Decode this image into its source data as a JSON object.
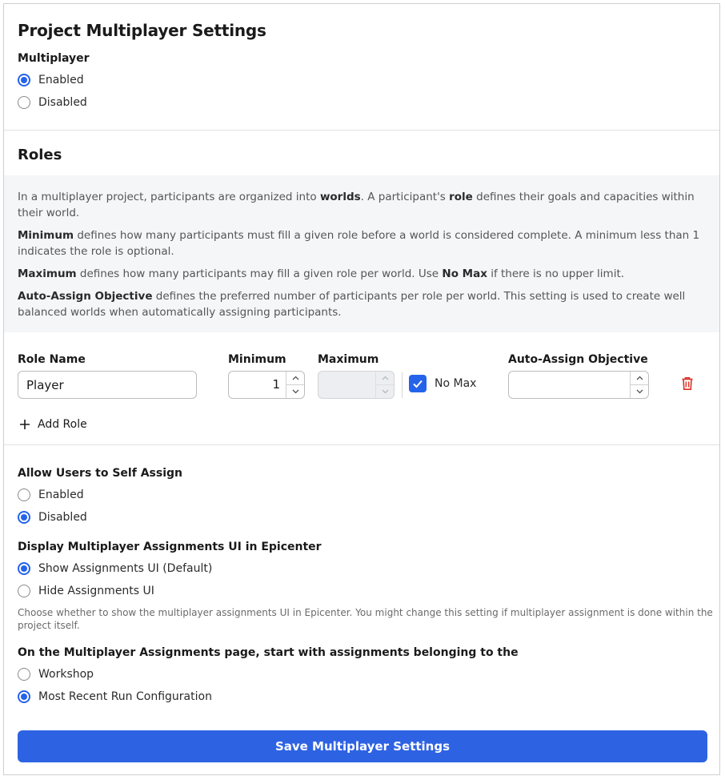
{
  "header": {
    "title": "Project Multiplayer Settings"
  },
  "multiplayer": {
    "label": "Multiplayer",
    "options": [
      "Enabled",
      "Disabled"
    ],
    "selected": "Enabled"
  },
  "roles": {
    "title": "Roles",
    "info": {
      "p1_pre": "In a multiplayer project, participants are organized into ",
      "p1_bold1": "worlds",
      "p1_mid": ". A participant's ",
      "p1_bold2": "role",
      "p1_post": " defines their goals and capacities within their world.",
      "p2_bold": "Minimum",
      "p2_text": " defines how many participants must fill a given role before a world is considered complete. A minimum less than 1 indicates the role is optional.",
      "p3_bold": "Maximum",
      "p3_text1": " defines how many participants may fill a given role per world. Use ",
      "p3_bold2": "No Max",
      "p3_text2": " if there is no upper limit.",
      "p4_bold": "Auto-Assign Objective",
      "p4_text": " defines the preferred number of participants per role per world. This setting is used to create well balanced worlds when automatically assigning participants."
    },
    "columns": {
      "role_name": "Role Name",
      "minimum": "Minimum",
      "maximum": "Maximum",
      "auto_assign": "Auto-Assign Objective"
    },
    "rows": [
      {
        "role_name": "Player",
        "minimum": "1",
        "maximum": "",
        "no_max": true,
        "no_max_label": "No Max",
        "auto_assign": ""
      }
    ],
    "add_role_label": "Add Role"
  },
  "self_assign": {
    "label": "Allow Users to Self Assign",
    "options": [
      "Enabled",
      "Disabled"
    ],
    "selected": "Disabled"
  },
  "display_ui": {
    "label": "Display Multiplayer Assignments UI in Epicenter",
    "options": [
      "Show Assignments UI (Default)",
      "Hide Assignments UI"
    ],
    "selected": "Show Assignments UI (Default)",
    "helper": "Choose whether to show the multiplayer assignments UI in Epicenter. You might change this setting if multiplayer assignment is done within the project itself."
  },
  "assignments_page": {
    "label": "On the Multiplayer Assignments page, start with assignments belonging to the",
    "options": [
      "Workshop",
      "Most Recent Run Configuration"
    ],
    "selected": "Most Recent Run Configuration"
  },
  "save_button": {
    "label": "Save Multiplayer Settings"
  },
  "colors": {
    "accent": "#2563eb",
    "delete": "#d93025"
  },
  "icons": {
    "delete": "trash-icon",
    "add": "plus-icon",
    "check": "checkmark-icon",
    "spin_up": "chevron-up-icon",
    "spin_down": "chevron-down-icon"
  }
}
